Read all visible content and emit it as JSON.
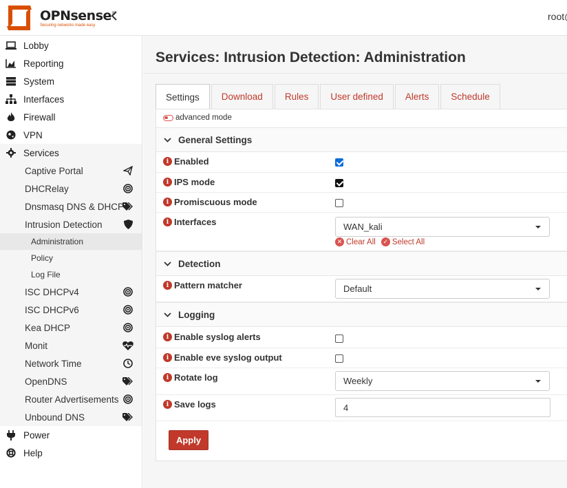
{
  "header": {
    "brand": "OPNsense",
    "tagline": "Securing networks made easy",
    "user": "root@"
  },
  "sidebar": {
    "items": [
      {
        "label": "Lobby",
        "icon": "laptop-icon"
      },
      {
        "label": "Reporting",
        "icon": "area-chart-icon"
      },
      {
        "label": "System",
        "icon": "server-icon"
      },
      {
        "label": "Interfaces",
        "icon": "sitemap-icon"
      },
      {
        "label": "Firewall",
        "icon": "fire-icon"
      },
      {
        "label": "VPN",
        "icon": "globe-icon"
      },
      {
        "label": "Services",
        "icon": "cog-icon"
      }
    ],
    "services_sub": [
      {
        "label": "Captive Portal",
        "icon": "send-icon"
      },
      {
        "label": "DHCRelay",
        "icon": "bullseye-icon"
      },
      {
        "label": "Dnsmasq DNS & DHCP",
        "icon": "tags-icon"
      },
      {
        "label": "Intrusion Detection",
        "icon": "shield-icon"
      }
    ],
    "ids_sub": [
      "Administration",
      "Policy",
      "Log File"
    ],
    "services_sub2": [
      {
        "label": "ISC DHCPv4",
        "icon": "bullseye-icon"
      },
      {
        "label": "ISC DHCPv6",
        "icon": "bullseye-icon"
      },
      {
        "label": "Kea DHCP",
        "icon": "bullseye-icon"
      },
      {
        "label": "Monit",
        "icon": "heartbeat-icon"
      },
      {
        "label": "Network Time",
        "icon": "clock-icon"
      },
      {
        "label": "OpenDNS",
        "icon": "tags-icon"
      },
      {
        "label": "Router Advertisements",
        "icon": "bullseye-icon"
      },
      {
        "label": "Unbound DNS",
        "icon": "tags-icon"
      }
    ],
    "bottom": [
      {
        "label": "Power",
        "icon": "plug-icon"
      },
      {
        "label": "Help",
        "icon": "life-ring-icon"
      }
    ]
  },
  "page": {
    "title": "Services: Intrusion Detection: Administration",
    "tabs": [
      "Settings",
      "Download",
      "Rules",
      "User defined",
      "Alerts",
      "Schedule"
    ],
    "advanced_mode": "advanced mode",
    "sections": {
      "general": "General Settings",
      "detection": "Detection",
      "logging": "Logging"
    },
    "fields": {
      "enabled": {
        "label": "Enabled",
        "checked": true
      },
      "ips_mode": {
        "label": "IPS mode",
        "checked": true
      },
      "promiscuous": {
        "label": "Promiscuous mode",
        "checked": false
      },
      "interfaces": {
        "label": "Interfaces",
        "value": "WAN_kali",
        "clear_all": "Clear All",
        "select_all": "Select All"
      },
      "pattern_matcher": {
        "label": "Pattern matcher",
        "value": "Default"
      },
      "syslog_alerts": {
        "label": "Enable syslog alerts",
        "checked": false
      },
      "eve_syslog": {
        "label": "Enable eve syslog output",
        "checked": false
      },
      "rotate_log": {
        "label": "Rotate log",
        "value": "Weekly"
      },
      "save_logs": {
        "label": "Save logs",
        "value": "4"
      }
    },
    "apply": "Apply"
  },
  "colors": {
    "accent": "#c0392b",
    "brand_orange": "#d94f00",
    "checkbox_blue": "#0b6cd8"
  }
}
